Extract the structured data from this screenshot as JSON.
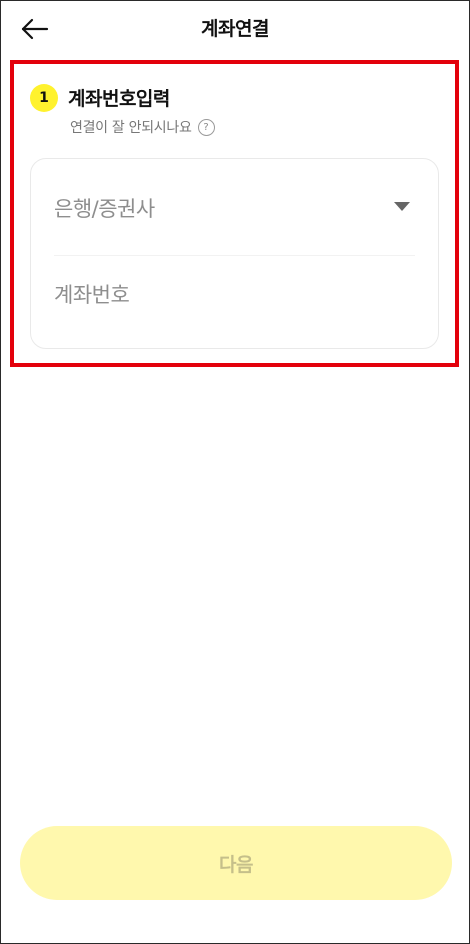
{
  "header": {
    "title": "계좌연결",
    "back_icon": "arrow-left-icon"
  },
  "step": {
    "number": "1",
    "title": "계좌번호입력",
    "help_text": "연결이 잘 안되시나요",
    "help_icon_glyph": "?"
  },
  "form": {
    "bank_placeholder": "은행/증권사",
    "bank_value": "",
    "account_placeholder": "계좌번호",
    "account_value": ""
  },
  "footer": {
    "next_label": "다음",
    "next_enabled": false
  },
  "colors": {
    "accent_yellow": "#fff22e",
    "next_button_disabled_bg": "#fff8ad",
    "highlight_red": "#e3000b"
  }
}
